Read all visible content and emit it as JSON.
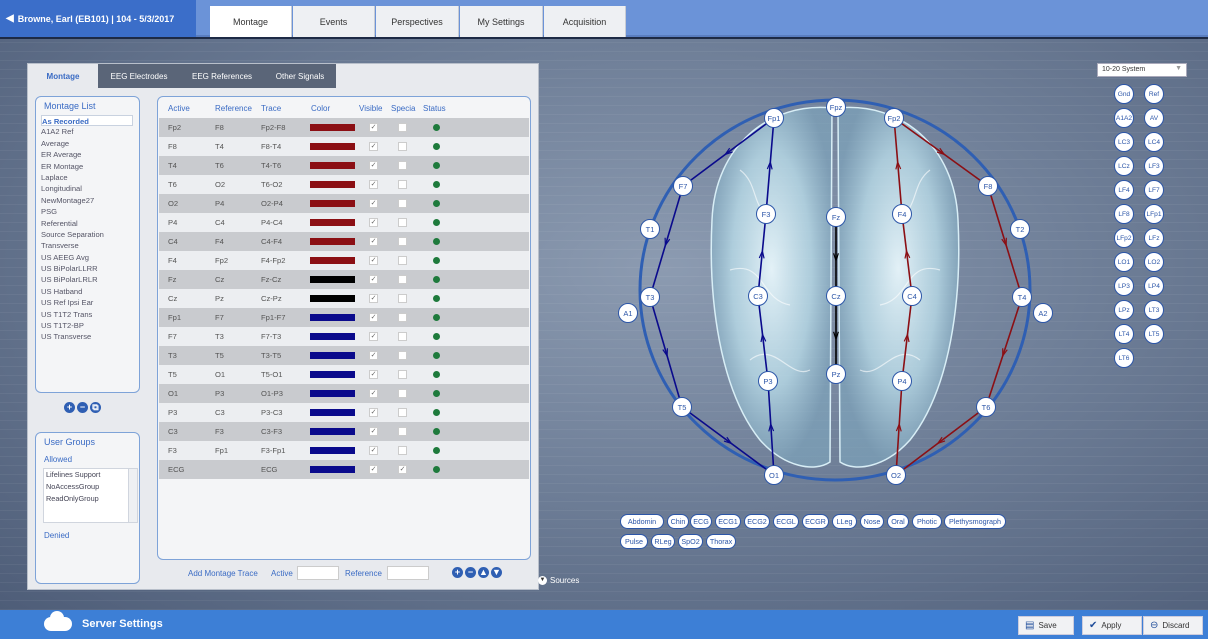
{
  "patient": {
    "back_icon": "back-arrow-icon",
    "label": "Browne, Earl (EB101)  |  104 - 5/3/2017"
  },
  "top_tabs": [
    "Montage",
    "Events",
    "Perspectives",
    "My Settings",
    "Acquisition"
  ],
  "sub_tabs": [
    "Montage",
    "EEG Electrodes",
    "EEG References",
    "Other Signals"
  ],
  "montage_list": {
    "title": "Montage List",
    "items": [
      "As Recorded",
      "A1A2 Ref",
      "Average",
      "ER Average",
      "ER Montage",
      "Laplace",
      "Longitudinal",
      "NewMontage27",
      "PSG",
      "Referential",
      "Source Separation",
      "Transverse",
      "US AEEG Avg",
      "US BiPolarLLRR",
      "US BiPolarLRLR",
      "US Hatband",
      "US Ref Ipsi Ear",
      "US T1T2 Trans",
      "US T1T2-BP",
      "US Transverse"
    ],
    "selected": "As Recorded"
  },
  "user_groups": {
    "title": "User Groups",
    "allowed_label": "Allowed",
    "allowed": [
      "Lifelines Support",
      "NoAccessGroup",
      "ReadOnlyGroup"
    ],
    "denied_label": "Denied"
  },
  "trace_table": {
    "headers": [
      "Active",
      "Reference",
      "Trace",
      "Color",
      "Visible",
      "Specia",
      "Status"
    ],
    "rows": [
      {
        "active": "Fp2",
        "reference": "F8",
        "trace": "Fp2-F8",
        "color": "#8b0f14",
        "visible": true,
        "special": false
      },
      {
        "active": "F8",
        "reference": "T4",
        "trace": "F8-T4",
        "color": "#8b0f14",
        "visible": true,
        "special": false
      },
      {
        "active": "T4",
        "reference": "T6",
        "trace": "T4-T6",
        "color": "#8b0f14",
        "visible": true,
        "special": false
      },
      {
        "active": "T6",
        "reference": "O2",
        "trace": "T6-O2",
        "color": "#8b0f14",
        "visible": true,
        "special": false
      },
      {
        "active": "O2",
        "reference": "P4",
        "trace": "O2-P4",
        "color": "#8b0f14",
        "visible": true,
        "special": false
      },
      {
        "active": "P4",
        "reference": "C4",
        "trace": "P4-C4",
        "color": "#8b0f14",
        "visible": true,
        "special": false
      },
      {
        "active": "C4",
        "reference": "F4",
        "trace": "C4-F4",
        "color": "#8b0f14",
        "visible": true,
        "special": false
      },
      {
        "active": "F4",
        "reference": "Fp2",
        "trace": "F4-Fp2",
        "color": "#8b0f14",
        "visible": true,
        "special": false
      },
      {
        "active": "Fz",
        "reference": "Cz",
        "trace": "Fz-Cz",
        "color": "#000000",
        "visible": true,
        "special": false
      },
      {
        "active": "Cz",
        "reference": "Pz",
        "trace": "Cz-Pz",
        "color": "#000000",
        "visible": true,
        "special": false
      },
      {
        "active": "Fp1",
        "reference": "F7",
        "trace": "Fp1-F7",
        "color": "#0a0a8c",
        "visible": true,
        "special": false
      },
      {
        "active": "F7",
        "reference": "T3",
        "trace": "F7-T3",
        "color": "#0a0a8c",
        "visible": true,
        "special": false
      },
      {
        "active": "T3",
        "reference": "T5",
        "trace": "T3-T5",
        "color": "#0a0a8c",
        "visible": true,
        "special": false
      },
      {
        "active": "T5",
        "reference": "O1",
        "trace": "T5-O1",
        "color": "#0a0a8c",
        "visible": true,
        "special": false
      },
      {
        "active": "O1",
        "reference": "P3",
        "trace": "O1-P3",
        "color": "#0a0a8c",
        "visible": true,
        "special": false
      },
      {
        "active": "P3",
        "reference": "C3",
        "trace": "P3-C3",
        "color": "#0a0a8c",
        "visible": true,
        "special": false
      },
      {
        "active": "C3",
        "reference": "F3",
        "trace": "C3-F3",
        "color": "#0a0a8c",
        "visible": true,
        "special": false
      },
      {
        "active": "F3",
        "reference": "Fp1",
        "trace": "F3-Fp1",
        "color": "#0a0a8c",
        "visible": true,
        "special": false
      },
      {
        "active": "ECG",
        "reference": "",
        "trace": "ECG",
        "color": "#0a0a8c",
        "visible": true,
        "special": true
      }
    ]
  },
  "add_trace": {
    "label": "Add Montage Trace",
    "active_label": "Active",
    "active_value": "",
    "reference_label": "Reference",
    "reference_value": ""
  },
  "system_select": "10-20 System",
  "electrodes": [
    "Fpz",
    "Fp1",
    "Fp2",
    "F7",
    "F3",
    "Fz",
    "F4",
    "F8",
    "T1",
    "T2",
    "A1",
    "T3",
    "C3",
    "Cz",
    "C4",
    "T4",
    "A2",
    "P3",
    "Pz",
    "P4",
    "T5",
    "T6",
    "O1",
    "O2"
  ],
  "extra_electrodes": [
    "Gnd",
    "Ref",
    "A1A2",
    "AV",
    "LC3",
    "LC4",
    "LCz",
    "LF3",
    "LF4",
    "LF7",
    "LF8",
    "LFp1",
    "LFp2",
    "LFz",
    "LO1",
    "LO2",
    "LP3",
    "LP4",
    "LPz",
    "LT3",
    "LT4",
    "LT5",
    "LT6"
  ],
  "other_signals": [
    "Abdomin",
    "Chin",
    "ECG",
    "ECG1",
    "ECG2",
    "ECGL",
    "ECGR",
    "LLeg",
    "Nose",
    "Oral",
    "Photic",
    "Plethysmograph",
    "Pulse",
    "RLeg",
    "SpO2",
    "Thorax"
  ],
  "sources_label": "Sources",
  "bottom": {
    "server_label": "Server Settings",
    "save_label": "Save",
    "apply_label": "Apply",
    "discard_label": "Discard"
  },
  "colors": {
    "accent": "#3a6bc4",
    "right_chain": "#8b0f14",
    "midline": "#000000",
    "left_chain": "#0a0a8c",
    "status_ok": "#1e7a3c"
  }
}
